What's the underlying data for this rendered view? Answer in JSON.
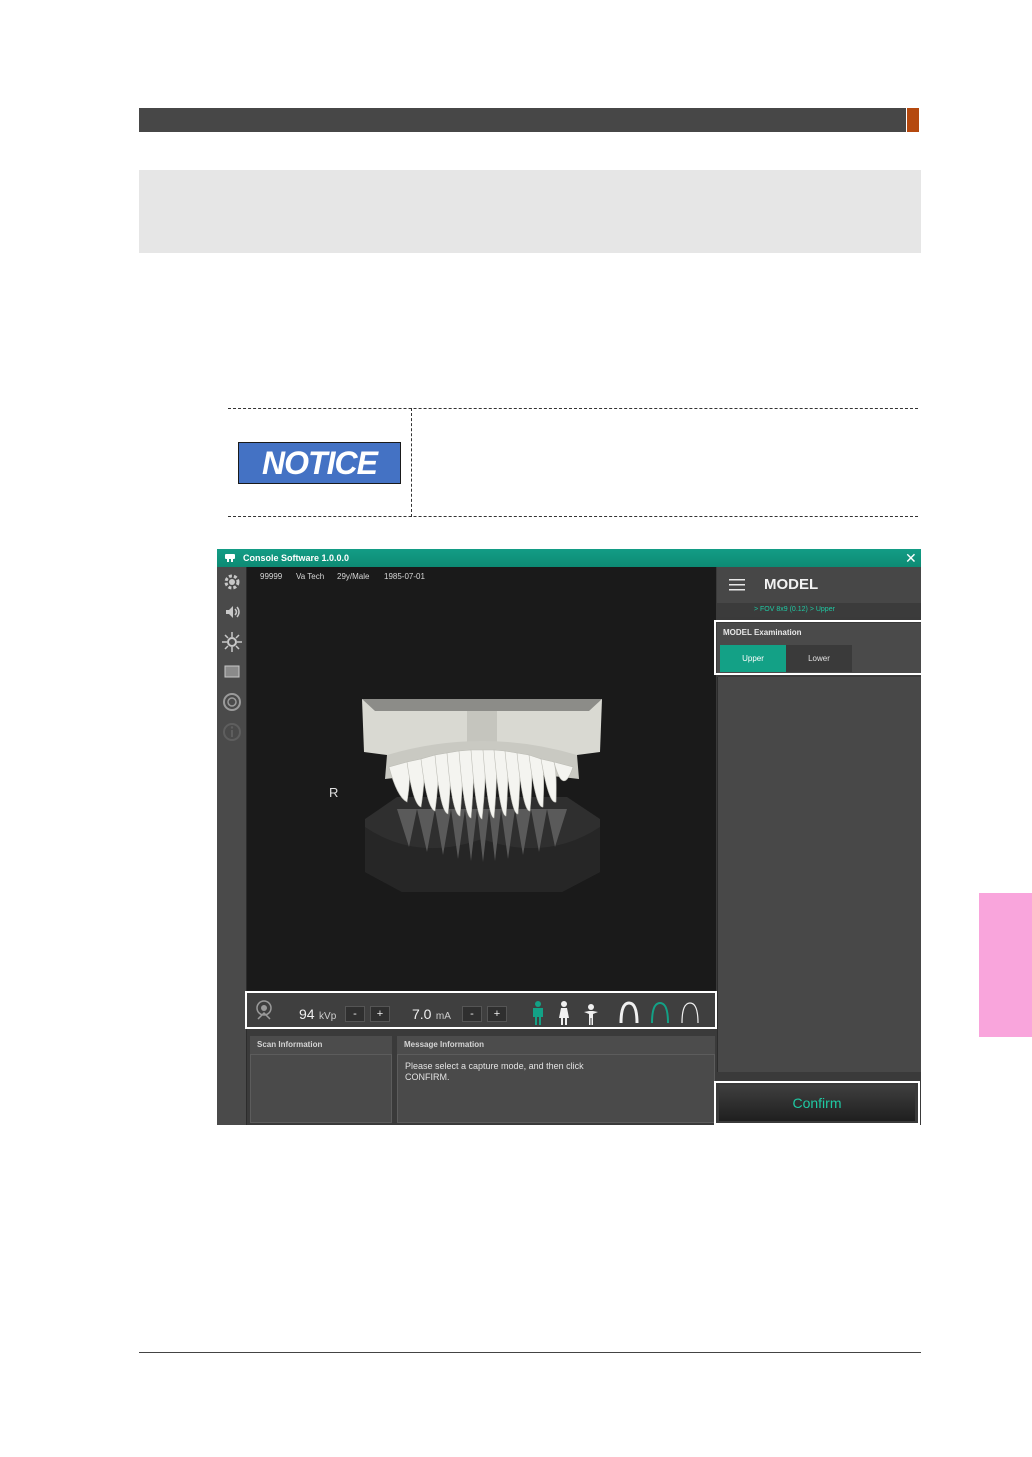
{
  "notice": {
    "badge": "NOTICE"
  },
  "app": {
    "title": "Console Software  1.0.0.0",
    "patient": {
      "id": "99999",
      "name": "Va Tech",
      "age_sex": "29y/Male",
      "dob": "1985-07-01"
    },
    "viewer": {
      "side_marker": "R"
    },
    "controls": {
      "kvp_value": "94",
      "kvp_unit": "kVp",
      "ma_value": "7.0",
      "ma_unit": "mA",
      "minus": "-",
      "plus": "+"
    },
    "panels": {
      "scan_title": "Scan Information",
      "message_title": "Message Information",
      "message_text": "Please select a capture mode, and then click CONFIRM."
    },
    "right": {
      "mode_title": "MODEL",
      "breadcrumb": "> FOV 8x9 (0.12) > Upper",
      "exam_label": "MODEL Examination",
      "option_upper": "Upper",
      "option_lower": "Lower",
      "confirm": "Confirm"
    },
    "icons": {
      "rail": [
        "gear-icon",
        "speaker-icon",
        "laser-icon",
        "monitor-icon",
        "target-icon",
        "info-icon"
      ],
      "accent": "#13a186"
    }
  }
}
